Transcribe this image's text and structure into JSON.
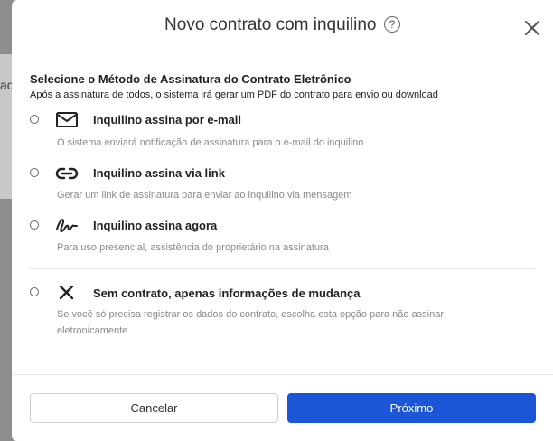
{
  "backdrop": {
    "partial_text": "ad"
  },
  "modal": {
    "title": "Novo contrato com inquilino",
    "help_glyph": "?",
    "section_title": "Selecione o Método de Assinatura do Contrato Eletrônico",
    "section_subtitle": "Após a assinatura de todos, o sistema irá gerar um PDF do contrato para envio ou download",
    "options": [
      {
        "label": "Inquilino assina por e-mail",
        "description": "O sistema enviará notificação de assinatura para o e-mail do inquilino",
        "icon": "envelope-icon",
        "selected": false
      },
      {
        "label": "Inquilino assina via link",
        "description": "Gerar um link de assinatura para enviar ao inquilino via mensagem",
        "icon": "link-icon",
        "selected": false
      },
      {
        "label": "Inquilino assina agora",
        "description": "Para uso presencial, assistência do proprietário na assinatura",
        "icon": "signature-icon",
        "selected": false
      },
      {
        "label": "Sem contrato, apenas informações de mudança",
        "description": "Se você só precisa registrar os dados do contrato, escolha esta opção para não assinar eletronicamente",
        "icon": "x-icon",
        "selected": false
      }
    ],
    "buttons": {
      "cancel": "Cancelar",
      "next": "Próximo"
    },
    "colors": {
      "primary": "#1a56d6",
      "text": "#222222",
      "muted": "#8a8a8a"
    }
  }
}
